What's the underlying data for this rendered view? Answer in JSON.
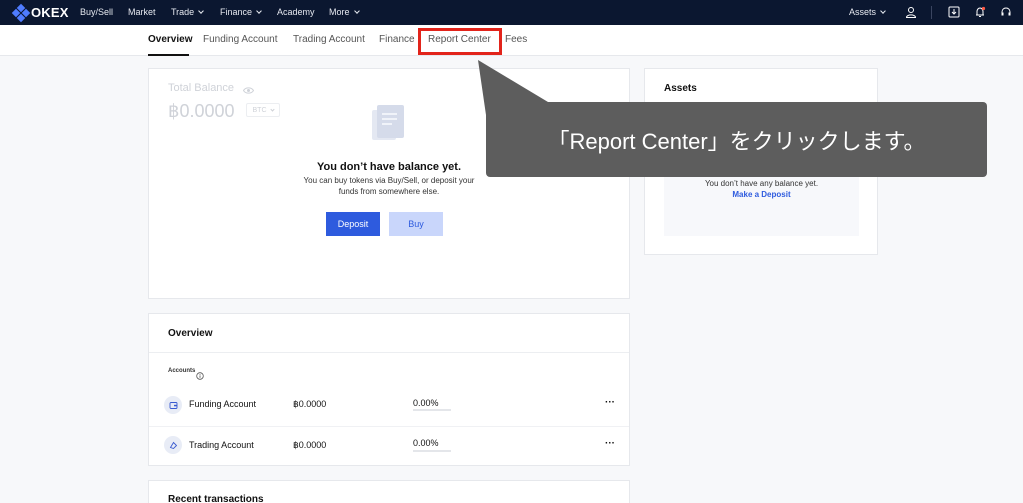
{
  "topnav": {
    "brand": "OKEX",
    "items": [
      {
        "label": "Buy/Sell"
      },
      {
        "label": "Market"
      },
      {
        "label": "Trade"
      },
      {
        "label": "Finance"
      },
      {
        "label": "Academy"
      },
      {
        "label": "More"
      }
    ],
    "assets_label": "Assets"
  },
  "subnav": {
    "tabs": [
      {
        "label": "Overview"
      },
      {
        "label": "Funding Account"
      },
      {
        "label": "Trading Account"
      },
      {
        "label": "Finance"
      },
      {
        "label": "Report Center"
      },
      {
        "label": "Fees"
      }
    ]
  },
  "balance": {
    "title": "Total Balance",
    "amount": "฿0.0000",
    "currency": "BTC",
    "empty_title": "You don’t have balance yet.",
    "empty_line1": "You can buy tokens via Buy/Sell, or deposit your",
    "empty_line2": "funds from somewhere else.",
    "deposit_label": "Deposit",
    "buy_label": "Buy"
  },
  "assets": {
    "title": "Assets",
    "empty_text": "You don’t have any balance yet.",
    "link_label": "Make a Deposit"
  },
  "overview": {
    "title": "Overview",
    "accounts_label": "Accounts",
    "rows": [
      {
        "name": "Funding Account",
        "balance": "฿0.0000",
        "percent": "0.00%"
      },
      {
        "name": "Trading Account",
        "balance": "฿0.0000",
        "percent": "0.00%"
      }
    ],
    "more_label": "···"
  },
  "recent": {
    "title": "Recent transactions"
  },
  "callout": {
    "text": "「Report Center」をクリックします。"
  },
  "colors": {
    "nav_bg": "#0b1730",
    "primary": "#2e5bde",
    "buy_bg": "#c9d6fb",
    "highlight": "#e2241b",
    "callout_bg": "#5d5d5d"
  }
}
